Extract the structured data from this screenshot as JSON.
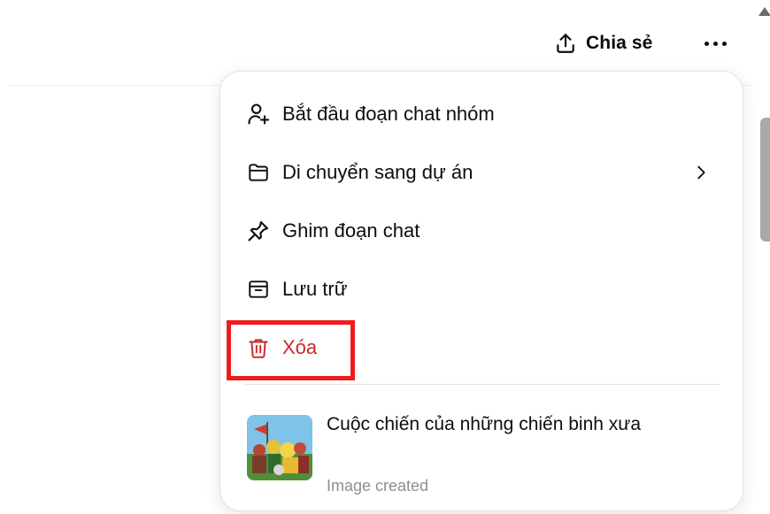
{
  "header": {
    "share_label": "Chia sẻ"
  },
  "menu": {
    "items": [
      {
        "label": "Bắt đầu đoạn chat nhóm",
        "icon": "user-plus-icon"
      },
      {
        "label": "Di chuyển sang dự án",
        "icon": "folder-icon",
        "submenu": true
      },
      {
        "label": "Ghim đoạn chat",
        "icon": "pin-icon"
      },
      {
        "label": "Lưu trữ",
        "icon": "archive-icon"
      },
      {
        "label": "Xóa",
        "icon": "trash-icon"
      }
    ],
    "recent": {
      "title": "Cuộc chiến của những chiến binh xưa",
      "subtitle": "Image created"
    }
  },
  "colors": {
    "danger": "#c7292e",
    "highlight": "#ee1c1c"
  }
}
